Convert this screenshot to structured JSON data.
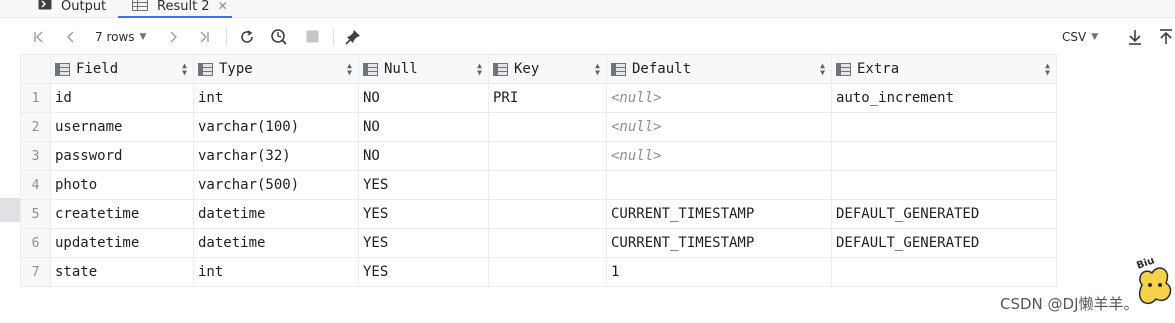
{
  "tabs": [
    {
      "label": "Output",
      "icon": "output-icon"
    },
    {
      "label": "Result 2",
      "icon": "table-icon",
      "active": true
    }
  ],
  "toolbar": {
    "rows_label": "7 rows",
    "export_format": "CSV"
  },
  "table": {
    "columns": [
      "Field",
      "Type",
      "Null",
      "Key",
      "Default",
      "Extra"
    ],
    "rows": [
      {
        "num": "1",
        "cells": [
          "id",
          "int",
          "NO",
          "PRI",
          "<null>",
          "auto_increment"
        ]
      },
      {
        "num": "2",
        "cells": [
          "username",
          "varchar(100)",
          "NO",
          "",
          "<null>",
          ""
        ]
      },
      {
        "num": "3",
        "cells": [
          "password",
          "varchar(32)",
          "NO",
          "",
          "<null>",
          ""
        ]
      },
      {
        "num": "4",
        "cells": [
          "photo",
          "varchar(500)",
          "YES",
          "",
          "",
          ""
        ]
      },
      {
        "num": "5",
        "cells": [
          "createtime",
          "datetime",
          "YES",
          "",
          "CURRENT_TIMESTAMP",
          "DEFAULT_GENERATED"
        ]
      },
      {
        "num": "6",
        "cells": [
          "updatetime",
          "datetime",
          "YES",
          "",
          "CURRENT_TIMESTAMP",
          "DEFAULT_GENERATED"
        ]
      },
      {
        "num": "7",
        "cells": [
          "state",
          "int",
          "YES",
          "",
          "1",
          ""
        ]
      }
    ]
  },
  "watermark": "CSDN @DJ懒羊羊。",
  "badge_text": "Biu",
  "colors": {
    "accent": "#3574f0",
    "header_bg": "#f7f8fa",
    "border": "#ebecf0",
    "null_text": "#8c8f96"
  }
}
